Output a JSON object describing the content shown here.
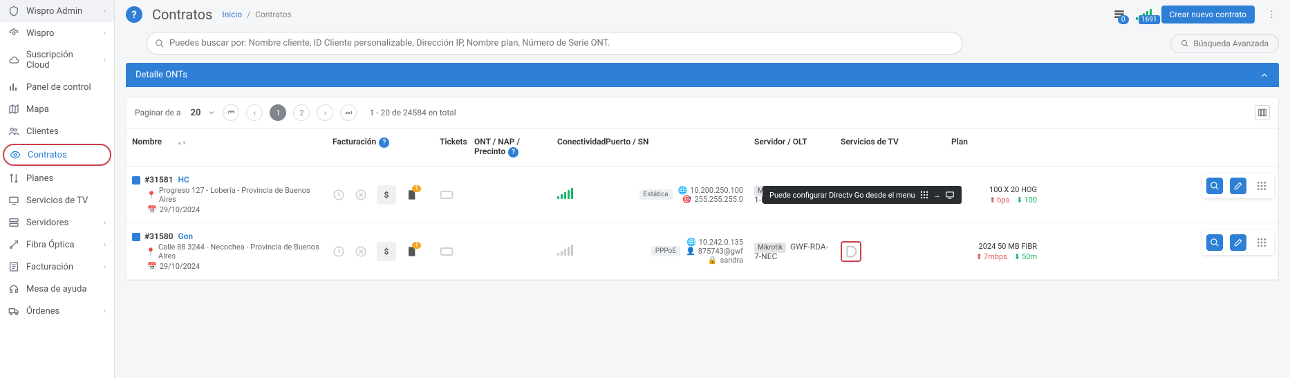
{
  "sidebar": {
    "items": [
      {
        "label": "Wispro Admin",
        "icon": "shield"
      },
      {
        "label": "Wispro",
        "icon": "cog"
      },
      {
        "label": "Suscripción Cloud",
        "icon": "cloud"
      },
      {
        "label": "Panel de control",
        "icon": "bars"
      },
      {
        "label": "Mapa",
        "icon": "map"
      },
      {
        "label": "Clientes",
        "icon": "users"
      },
      {
        "label": "Contratos",
        "icon": "eye"
      },
      {
        "label": "Planes",
        "icon": "arrows"
      },
      {
        "label": "Servicios de TV",
        "icon": "tv"
      },
      {
        "label": "Servidores",
        "icon": "server"
      },
      {
        "label": "Fibra Óptica",
        "icon": "fiber"
      },
      {
        "label": "Facturación",
        "icon": "invoice"
      },
      {
        "label": "Mesa de ayuda",
        "icon": "headset"
      },
      {
        "label": "Órdenes",
        "icon": "truck"
      }
    ]
  },
  "header": {
    "title": "Contratos",
    "breadcrumb_home": "Inicio",
    "breadcrumb_current": "Contratos",
    "stack_badge": "0",
    "signal_badge": "1691",
    "new_button": "Crear nuevo contrato"
  },
  "search": {
    "placeholder": "Puedes buscar por: Nombre cliente, ID Cliente personalizable, Dirección IP, Nombre plan, Número de Serie ONT.",
    "advanced": "Búsqueda Avanzada"
  },
  "panel": {
    "title": "Detalle ONTs"
  },
  "pager": {
    "label": "Paginar de a",
    "size": "20",
    "pages": [
      "1",
      "2"
    ],
    "total": "1 - 20 de 24584 en total"
  },
  "columns": {
    "nombre": "Nombre",
    "facturacion": "Facturación",
    "tickets": "Tickets",
    "ont": "ONT / NAP / Precinto",
    "conectividad": "Conectividad",
    "puerto": "Puerto / SN",
    "servidor": "Servidor / OLT",
    "tv": "Servicios de TV",
    "plan": "Plan"
  },
  "tooltip": "Puede configurar Directv Go desde el menu",
  "rows": [
    {
      "id": "#31581",
      "name": "HC",
      "address": "Progreso 127 - Lobería - Provincia de Buenos Aires",
      "date": "29/10/2024",
      "doc_badge": "1",
      "conn_tag": "Estática",
      "ip": "10.200.250.100",
      "mask": "255.255.255.0",
      "mk": "Mikrotik",
      "olt": "GWF-RDA-1-LOB",
      "plan": "100 X 20 HOG",
      "up": "bps",
      "down": "100",
      "signal_strong": true
    },
    {
      "id": "#31580",
      "name": "Gon",
      "address": "Calle 88 3244 - Necochea - Provincia de Buenos Aires",
      "date": "29/10/2024",
      "doc_badge": "1",
      "conn_tag": "PPPoE",
      "ip": "10.242.0.135",
      "user": "875743@gwf",
      "lock": "sandra",
      "mk": "Mikrotik",
      "olt": "GWF-RDA-7-NEC",
      "plan": "2024 50 MB FIBR",
      "up": "7mbps",
      "down": "50m",
      "signal_strong": false,
      "tv_highlight": true
    }
  ]
}
